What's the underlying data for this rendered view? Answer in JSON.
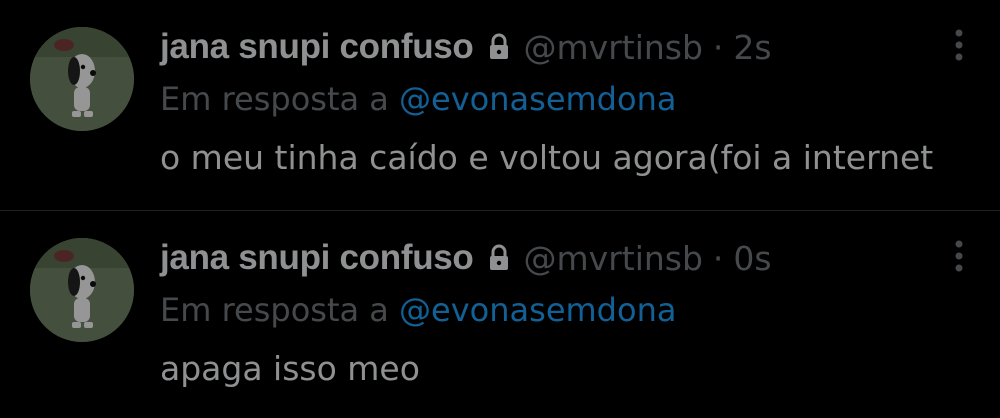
{
  "tweets": [
    {
      "author_name": "jana snupi confuso",
      "handle": "@mvrtinsb",
      "separator": "·",
      "time": "2s",
      "reply_prefix": "Em resposta a",
      "reply_mention": "@evonasemdona",
      "text": "o meu tinha caído e voltou agora(foi a internet",
      "icons": {
        "lock": "lock-icon",
        "more": "more-vertical-icon"
      }
    },
    {
      "author_name": "jana snupi confuso",
      "handle": "@mvrtinsb",
      "separator": "·",
      "time": "0s",
      "reply_prefix": "Em resposta a",
      "reply_mention": "@evonasemdona",
      "text": "apaga isso meo",
      "icons": {
        "lock": "lock-icon",
        "more": "more-vertical-icon"
      }
    }
  ],
  "colors": {
    "background": "#000000",
    "name": "#e7e9ea",
    "secondary": "#71767b",
    "mention": "#1d9bf0",
    "divider": "#2f3336",
    "avatar_bg": "#6e8063"
  }
}
